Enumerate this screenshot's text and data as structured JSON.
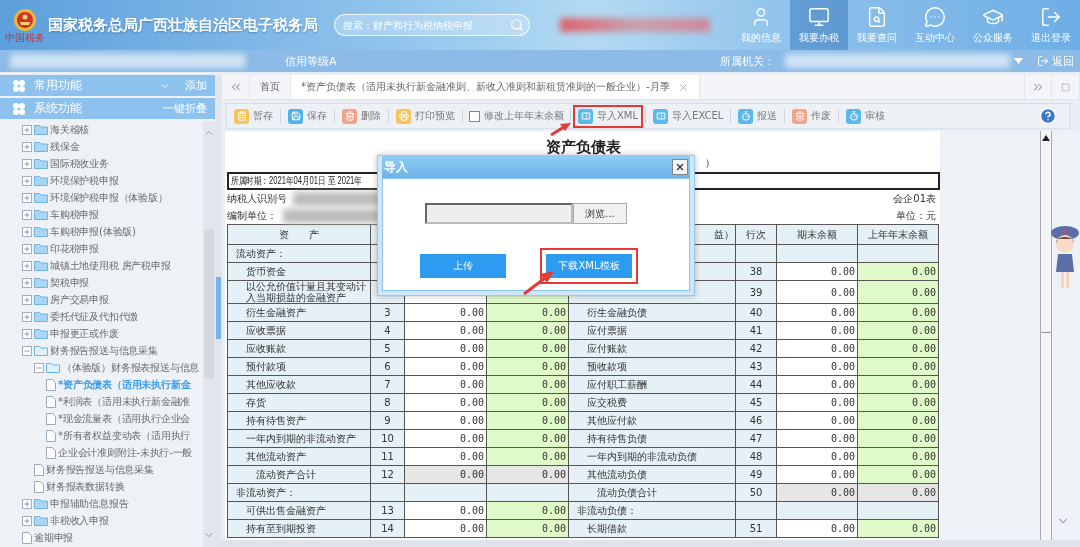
{
  "header": {
    "logo_caption": "中国税务",
    "title": "国家税务总局广西壮族自治区电子税务局",
    "search": {
      "placeholder": "搜索：财产和行为税纳税申报"
    },
    "nav": [
      {
        "label": "我的信息",
        "selected": false
      },
      {
        "label": "我要办税",
        "selected": true
      },
      {
        "label": "我要查问",
        "selected": false
      },
      {
        "label": "互动中心",
        "selected": false
      },
      {
        "label": "公众服务",
        "selected": false
      },
      {
        "label": "退出登录",
        "selected": false
      }
    ]
  },
  "info_bar": {
    "credit": "信用等级A",
    "authority_label": "所属机关：",
    "back": "返回"
  },
  "sidebar": {
    "sections": [
      {
        "label": "常用功能",
        "action": "添加",
        "collapsible": true
      },
      {
        "label": "系统功能",
        "action": "一键折叠",
        "collapsible": false
      }
    ],
    "tree": [
      {
        "label": "海关稽核",
        "kind": "folder",
        "expanded": false,
        "selected": false
      },
      {
        "label": "残保金",
        "kind": "folder",
        "expanded": false,
        "selected": false
      },
      {
        "label": "国际税收业务",
        "kind": "folder",
        "expanded": false,
        "selected": false
      },
      {
        "label": "环境保护税申报",
        "kind": "folder",
        "expanded": false,
        "selected": false
      },
      {
        "label": "环境保护税申报（体验版）",
        "kind": "folder",
        "expanded": false,
        "selected": false
      },
      {
        "label": "车购税申报",
        "kind": "folder",
        "expanded": false,
        "selected": false
      },
      {
        "label": "车购税申报(体验版)",
        "kind": "folder",
        "expanded": false,
        "selected": false
      },
      {
        "label": "印花税申报",
        "kind": "folder",
        "expanded": false,
        "selected": false
      },
      {
        "label": "城镇土地使用税 房产税申报",
        "kind": "folder",
        "expanded": false,
        "selected": false
      },
      {
        "label": "契税申报",
        "kind": "folder",
        "expanded": false,
        "selected": false
      },
      {
        "label": "房产交易申报",
        "kind": "folder",
        "expanded": false,
        "selected": false
      },
      {
        "label": "委托代征及代扣代缴",
        "kind": "folder",
        "expanded": false,
        "selected": false
      },
      {
        "label": "申报更正或作废",
        "kind": "folder",
        "expanded": false,
        "selected": false
      },
      {
        "label": "财务报告报送与信息采集",
        "kind": "folder",
        "expanded": true,
        "selected": false,
        "children": [
          {
            "label": "（体验版）财务报表报送与信息",
            "kind": "folder",
            "expanded": true,
            "selected": false,
            "children": [
              {
                "label": "*资产负债表（适用未执行新金",
                "kind": "doc",
                "selected": true
              },
              {
                "label": "*利润表（适用未执行新金融准",
                "kind": "doc",
                "selected": false
              },
              {
                "label": "*现金流量表（适用执行企业会",
                "kind": "doc",
                "selected": false
              },
              {
                "label": "*所有者权益变动表（适用执行",
                "kind": "doc",
                "selected": false
              },
              {
                "label": "企业会计准则附注-未执行-一般",
                "kind": "doc",
                "selected": false
              }
            ]
          },
          {
            "label": "财务报告报送与信息采集",
            "kind": "doc",
            "selected": false
          },
          {
            "label": "财务报表数据转换",
            "kind": "doc",
            "selected": false
          }
        ]
      },
      {
        "label": "申报辅助信息报告",
        "kind": "folder",
        "expanded": false,
        "selected": false
      },
      {
        "label": "非税收入申报",
        "kind": "folder",
        "expanded": false,
        "selected": false
      },
      {
        "label": "逾期申报",
        "kind": "doc",
        "selected": false
      }
    ]
  },
  "tabs": [
    {
      "label": "首页",
      "selected": false,
      "closable": false
    },
    {
      "label": "*资产负债表（适用未执行新金融准则、新收入准则和新租赁准则的一般企业）-月季",
      "selected": true,
      "closable": true
    }
  ],
  "toolbar": [
    {
      "kind": "button",
      "label": "暂存",
      "color": "#f4c55c",
      "highlighted": false
    },
    {
      "kind": "button",
      "label": "保存",
      "color": "#4fb3e8",
      "highlighted": false
    },
    {
      "kind": "button",
      "label": "删除",
      "color": "#f0a48a",
      "highlighted": false
    },
    {
      "kind": "button",
      "label": "打印预览",
      "color": "#f4c55c",
      "highlighted": false
    },
    {
      "kind": "checkbox",
      "label": "修改上年年末余额",
      "checked": false
    },
    {
      "kind": "button",
      "label": "导入XML",
      "color": "#5ab8ea",
      "highlighted": true
    },
    {
      "kind": "button",
      "label": "导入EXCEL",
      "color": "#5ab8ea",
      "highlighted": false
    },
    {
      "kind": "button",
      "label": "报送",
      "color": "#5ab8ea",
      "highlighted": false
    },
    {
      "kind": "button",
      "label": "作废",
      "color": "#f0a48a",
      "highlighted": false
    },
    {
      "kind": "button",
      "label": "审核",
      "color": "#5ab8ea",
      "highlighted": false
    }
  ],
  "report": {
    "title": "资产负债表",
    "subtitle": "）",
    "period": "所属时期：2021年04月01日 至 2021年",
    "taxpayer_label": "纳税人识别号",
    "form_code": "会企01表",
    "unit_label": "编制单位：",
    "unit": "单位：元",
    "header": {
      "asset": "资　　产",
      "liability": "益）",
      "line": "行次",
      "end": "期末余额",
      "prior": "上年年末余额"
    },
    "rows": [
      {
        "left": {
          "kind": "section",
          "name": "流动资产："
        },
        "right": {
          "kind": "section"
        }
      },
      {
        "left": {
          "kind": "normal",
          "name": "货币资金"
        },
        "right": {
          "kind": "normal",
          "line": "38",
          "end": "0.00",
          "prior": "0.00"
        }
      },
      {
        "left": {
          "kind": "normal",
          "name": "以公允价值计量且其变动计入当期损益的金融资产"
        },
        "right": {
          "kind": "normal",
          "line": "39",
          "end": "0.00",
          "prior": "0.00"
        }
      },
      {
        "left": {
          "kind": "normal",
          "name": "衍生金融资产",
          "line": "3",
          "end": "0.00",
          "prior": "0.00"
        },
        "right": {
          "kind": "normal",
          "name": "衍生金融负债",
          "line": "40",
          "end": "0.00",
          "prior": "0.00"
        }
      },
      {
        "left": {
          "kind": "normal",
          "name": "应收票据",
          "line": "4",
          "end": "0.00",
          "prior": "0.00"
        },
        "right": {
          "kind": "normal",
          "name": "应付票据",
          "line": "41",
          "end": "0.00",
          "prior": "0.00"
        }
      },
      {
        "left": {
          "kind": "normal",
          "name": "应收账款",
          "line": "5",
          "end": "0.00",
          "prior": "0.00"
        },
        "right": {
          "kind": "normal",
          "name": "应付账款",
          "line": "42",
          "end": "0.00",
          "prior": "0.00"
        }
      },
      {
        "left": {
          "kind": "normal",
          "name": "预付款项",
          "line": "6",
          "end": "0.00",
          "prior": "0.00"
        },
        "right": {
          "kind": "normal",
          "name": "预收款项",
          "line": "43",
          "end": "0.00",
          "prior": "0.00"
        }
      },
      {
        "left": {
          "kind": "normal",
          "name": "其他应收款",
          "line": "7",
          "end": "0.00",
          "prior": "0.00"
        },
        "right": {
          "kind": "normal",
          "name": "应付职工薪酬",
          "line": "44",
          "end": "0.00",
          "prior": "0.00"
        }
      },
      {
        "left": {
          "kind": "normal",
          "name": "存货",
          "line": "8",
          "end": "0.00",
          "prior": "0.00"
        },
        "right": {
          "kind": "normal",
          "name": "应交税费",
          "line": "45",
          "end": "0.00",
          "prior": "0.00"
        }
      },
      {
        "left": {
          "kind": "normal",
          "name": "持有待售资产",
          "line": "9",
          "end": "0.00",
          "prior": "0.00"
        },
        "right": {
          "kind": "normal",
          "name": "其他应付款",
          "line": "46",
          "end": "0.00",
          "prior": "0.00"
        }
      },
      {
        "left": {
          "kind": "normal",
          "name": "一年内到期的非流动资产",
          "line": "10",
          "end": "0.00",
          "prior": "0.00"
        },
        "right": {
          "kind": "normal",
          "name": "持有待售负债",
          "line": "47",
          "end": "0.00",
          "prior": "0.00"
        }
      },
      {
        "left": {
          "kind": "normal",
          "name": "其他流动资产",
          "line": "11",
          "end": "0.00",
          "prior": "0.00"
        },
        "right": {
          "kind": "normal",
          "name": "一年内到期的非流动负债",
          "line": "48",
          "end": "0.00",
          "prior": "0.00"
        }
      },
      {
        "left": {
          "kind": "total",
          "name": "流动资产合计",
          "line": "12",
          "end": "0.00",
          "prior": "0.00"
        },
        "right": {
          "kind": "normal",
          "name": "其他流动负债",
          "line": "49",
          "end": "0.00",
          "prior": "0.00"
        }
      },
      {
        "left": {
          "kind": "section",
          "name": "非流动资产："
        },
        "right": {
          "kind": "total",
          "name": "流动负债合计",
          "line": "50",
          "end": "0.00",
          "prior": "0.00"
        }
      },
      {
        "left": {
          "kind": "normal",
          "name": "可供出售金融资产",
          "line": "13",
          "end": "0.00",
          "prior": "0.00"
        },
        "right": {
          "kind": "section",
          "name": "非流动负债："
        }
      },
      {
        "left": {
          "kind": "normal",
          "name": "持有至到期投资",
          "line": "14",
          "end": "0.00",
          "prior": "0.00"
        },
        "right": {
          "kind": "normal",
          "name": "长期借款",
          "line": "51",
          "end": "0.00",
          "prior": "0.00"
        }
      }
    ]
  },
  "dialog": {
    "title": "导入",
    "browse": "浏览...",
    "buttons": [
      {
        "label": "上传",
        "highlighted": false
      },
      {
        "label": "下载XML模板",
        "highlighted": true
      }
    ]
  }
}
